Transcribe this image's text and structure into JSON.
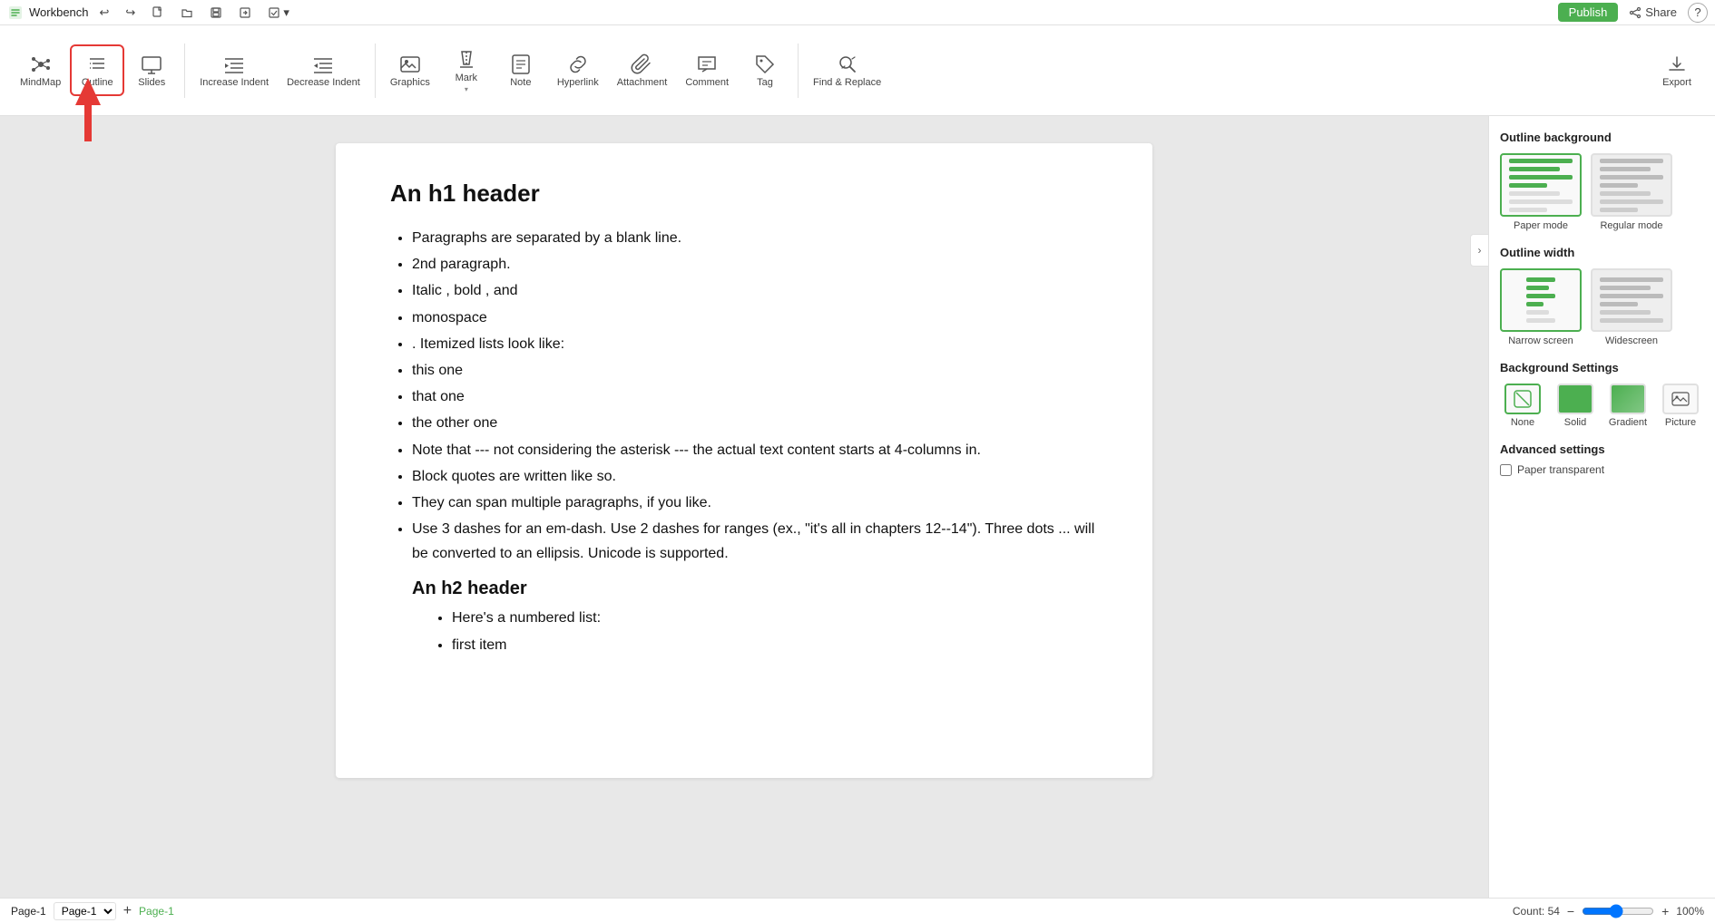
{
  "app": {
    "name": "Workbench"
  },
  "topbar": {
    "undo_label": "↩",
    "redo_label": "↪",
    "publish_label": "Publish",
    "share_label": "Share",
    "help_label": "?"
  },
  "toolbar": {
    "mindmap_label": "MindMap",
    "outline_label": "Outline",
    "slides_label": "Slides",
    "increase_indent_label": "Increase Indent",
    "decrease_indent_label": "Decrease Indent",
    "graphics_label": "Graphics",
    "mark_label": "Mark",
    "note_label": "Note",
    "hyperlink_label": "Hyperlink",
    "attachment_label": "Attachment",
    "comment_label": "Comment",
    "tag_label": "Tag",
    "find_replace_label": "Find & Replace",
    "export_label": "Export"
  },
  "content": {
    "h1": "An h1 header",
    "bullets": [
      "Paragraphs are separated by a blank line.",
      "2nd paragraph.",
      "Italic , bold , and",
      "monospace",
      ". Itemized lists look like:",
      "this one",
      "that one",
      "the other one",
      "Note that --- not considering the asterisk --- the actual text content starts at 4-columns in.",
      "Block quotes are written like so.",
      "They can span multiple paragraphs, if you like.",
      "Use 3 dashes for an em-dash. Use 2 dashes for ranges (ex., \"it's all in chapters 12--14\"). Three dots ... will be converted to an ellipsis. Unicode is supported.",
      "An h2 header"
    ],
    "sub_bullets": [
      "Here's a numbered list:",
      "first item"
    ]
  },
  "right_panel": {
    "outline_background_title": "Outline background",
    "paper_mode_label": "Paper mode",
    "regular_mode_label": "Regular mode",
    "outline_width_title": "Outline width",
    "narrow_screen_label": "Narrow screen",
    "widescreen_label": "Widescreen",
    "background_settings_title": "Background Settings",
    "bg_none_label": "None",
    "bg_solid_label": "Solid",
    "bg_gradient_label": "Gradient",
    "bg_picture_label": "Picture",
    "advanced_settings_title": "Advanced settings",
    "paper_transparent_label": "Paper transparent"
  },
  "statusbar": {
    "page_label": "Page-1",
    "page_tab": "Page-1",
    "add_page_label": "+",
    "count_label": "Count: 54",
    "zoom_minus": "−",
    "zoom_plus": "+",
    "zoom_level": "100%"
  }
}
